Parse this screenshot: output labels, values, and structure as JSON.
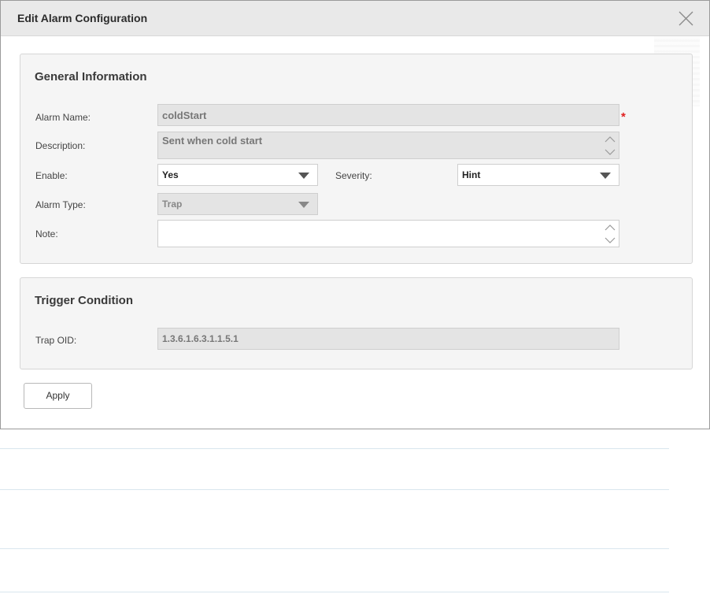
{
  "dialog": {
    "title": "Edit Alarm Configuration"
  },
  "general": {
    "section_title": "General Information",
    "alarm_name_label": "Alarm Name:",
    "alarm_name_value": "coldStart",
    "required_marker": "*",
    "description_label": "Description:",
    "description_value": "Sent when cold start",
    "enable_label": "Enable:",
    "enable_value": "Yes",
    "severity_label": "Severity:",
    "severity_value": "Hint",
    "alarm_type_label": "Alarm Type:",
    "alarm_type_value": "Trap",
    "note_label": "Note:",
    "note_value": ""
  },
  "trigger": {
    "section_title": "Trigger Condition",
    "trap_oid_label": "Trap OID:",
    "trap_oid_value": "1.3.6.1.6.3.1.1.5.1"
  },
  "actions": {
    "apply_label": "Apply"
  },
  "colors": {
    "required": "#e02020",
    "titlebar": "#e9e9e9",
    "fieldset_bg": "#f5f5f5",
    "readonly_bg": "#e4e4e4"
  }
}
